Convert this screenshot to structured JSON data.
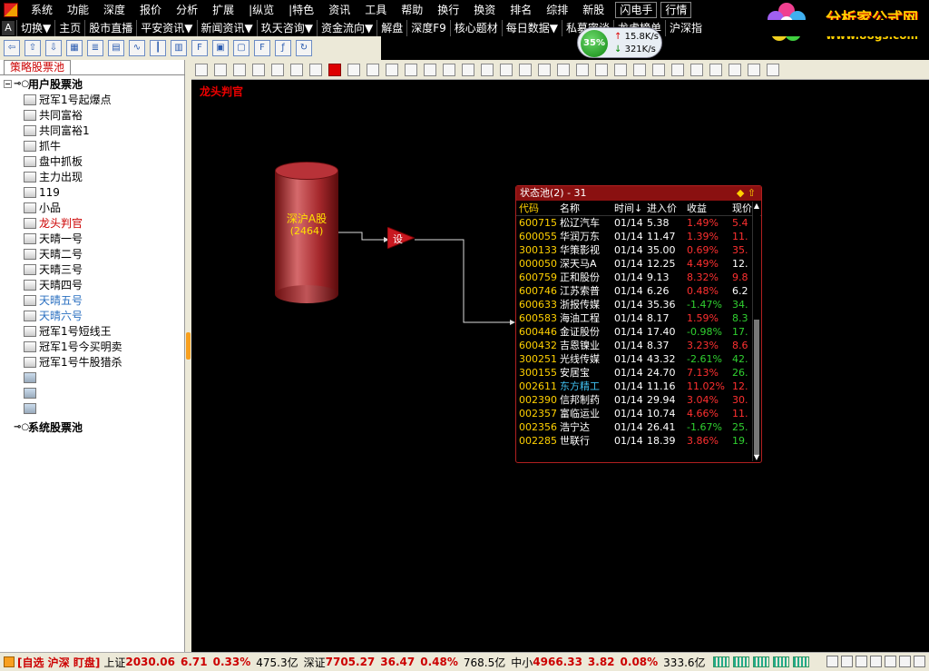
{
  "menu": {
    "items": [
      "系统",
      "功能",
      "深度",
      "报价",
      "分析",
      "扩展",
      "|纵览",
      "|特色",
      "资讯",
      "工具",
      "帮助",
      "换行",
      "换资",
      "排名",
      "综排",
      "新股"
    ],
    "right_buttons": [
      "闪电手",
      "行情"
    ]
  },
  "brand": {
    "title": "分析家公式网",
    "url": "www.88gs.com"
  },
  "navbar": {
    "items": [
      "切换▼",
      "主页",
      "股市直播",
      "平安资讯▼",
      "新闻资讯▼",
      "玖天咨询▼",
      "资金流向▼",
      "解盘",
      "深度F9",
      "核心题材",
      "每日数据▼",
      "私募密谈",
      "龙虎榜单",
      "沪深指"
    ]
  },
  "speed": {
    "percent": "35%",
    "up": "15.8K/s",
    "down": "321K/s"
  },
  "left_panel": {
    "tab": "策略股票池",
    "user_root": "用户股票池",
    "system_root": "系统股票池",
    "user_items": [
      {
        "label": "冠军1号起爆点",
        "style": ""
      },
      {
        "label": "共同富裕",
        "style": ""
      },
      {
        "label": "共同富裕1",
        "style": ""
      },
      {
        "label": "抓牛",
        "style": ""
      },
      {
        "label": "盘中抓板",
        "style": ""
      },
      {
        "label": "主力出现",
        "style": ""
      },
      {
        "label": "119",
        "style": ""
      },
      {
        "label": "小品",
        "style": ""
      },
      {
        "label": "龙头判官",
        "style": "red"
      },
      {
        "label": "天晴一号",
        "style": ""
      },
      {
        "label": "天晴二号",
        "style": ""
      },
      {
        "label": "天晴三号",
        "style": ""
      },
      {
        "label": "天晴四号",
        "style": ""
      },
      {
        "label": "天晴五号",
        "style": "blue"
      },
      {
        "label": "天晴六号",
        "style": "blue"
      },
      {
        "label": "冠军1号短线王",
        "style": ""
      },
      {
        "label": "冠军1号今买明卖",
        "style": ""
      },
      {
        "label": "冠军1号牛股猎杀",
        "style": ""
      },
      {
        "label": "",
        "style": "blank"
      },
      {
        "label": "",
        "style": "blank"
      },
      {
        "label": "",
        "style": "blank"
      }
    ]
  },
  "canvas": {
    "title": "龙头判官",
    "source": {
      "label": "深沪A股",
      "count": "(2464)"
    },
    "filter_label": "设"
  },
  "pool": {
    "title": "状态池(2) - 31",
    "columns": [
      "代码",
      "名称",
      "时间↓",
      "进入价",
      "收益",
      "现价"
    ],
    "rows": [
      {
        "code": "600715",
        "name": "松辽汽车",
        "time": "01/14",
        "price": "5.38",
        "gain": "1.49%",
        "cur": "5.4",
        "dir": "up"
      },
      {
        "code": "600055",
        "name": "华润万东",
        "time": "01/14",
        "price": "11.47",
        "gain": "1.39%",
        "cur": "11.",
        "dir": "up"
      },
      {
        "code": "300133",
        "name": "华策影视",
        "time": "01/14",
        "price": "35.00",
        "gain": "0.69%",
        "cur": "35.",
        "dir": "up"
      },
      {
        "code": "000050",
        "name": "深天马A",
        "time": "01/14",
        "price": "12.25",
        "gain": "4.49%",
        "cur": "12.",
        "dir": "flat"
      },
      {
        "code": "600759",
        "name": "正和股份",
        "time": "01/14",
        "price": "9.13",
        "gain": "8.32%",
        "cur": "9.8",
        "dir": "up"
      },
      {
        "code": "600746",
        "name": "江苏索普",
        "time": "01/14",
        "price": "6.26",
        "gain": "0.48%",
        "cur": "6.2",
        "dir": "flat"
      },
      {
        "code": "600633",
        "name": "浙报传媒",
        "time": "01/14",
        "price": "35.36",
        "gain": "-1.47%",
        "cur": "34.",
        "dir": "down"
      },
      {
        "code": "600583",
        "name": "海油工程",
        "time": "01/14",
        "price": "8.17",
        "gain": "1.59%",
        "cur": "8.3",
        "dir": "gdown"
      },
      {
        "code": "600446",
        "name": "金证股份",
        "time": "01/14",
        "price": "17.40",
        "gain": "-0.98%",
        "cur": "17.",
        "dir": "down"
      },
      {
        "code": "600432",
        "name": "吉恩镍业",
        "time": "01/14",
        "price": "8.37",
        "gain": "3.23%",
        "cur": "8.6",
        "dir": "up"
      },
      {
        "code": "300251",
        "name": "光线传媒",
        "time": "01/14",
        "price": "43.32",
        "gain": "-2.61%",
        "cur": "42.",
        "dir": "down"
      },
      {
        "code": "300155",
        "name": "安居宝",
        "time": "01/14",
        "price": "24.70",
        "gain": "7.13%",
        "cur": "26.",
        "dir": "gdown"
      },
      {
        "code": "002611",
        "name": "东方精工",
        "time": "01/14",
        "price": "11.16",
        "gain": "11.02%",
        "cur": "12.",
        "dir": "up",
        "cyan": true
      },
      {
        "code": "002390",
        "name": "信邦制药",
        "time": "01/14",
        "price": "29.94",
        "gain": "3.04%",
        "cur": "30.",
        "dir": "up"
      },
      {
        "code": "002357",
        "name": "富临运业",
        "time": "01/14",
        "price": "10.74",
        "gain": "4.66%",
        "cur": "11.",
        "dir": "up"
      },
      {
        "code": "002356",
        "name": "浩宁达",
        "time": "01/14",
        "price": "26.41",
        "gain": "-1.67%",
        "cur": "25.",
        "dir": "down"
      },
      {
        "code": "002285",
        "name": "世联行",
        "time": "01/14",
        "price": "18.39",
        "gain": "3.86%",
        "cur": "19.",
        "dir": "gdown"
      }
    ]
  },
  "statusbar": {
    "tag": "[自选 沪深 盯盘]",
    "sh_name": "上证",
    "sh_index": "2030.06",
    "sh_change": "6.71",
    "sh_pct": "0.33%",
    "sh_vol": "475.3亿",
    "sz_name": "深证",
    "sz_index": "7705.27",
    "sz_change": "36.47",
    "sz_pct": "0.48%",
    "sz_vol": "768.5亿",
    "zx_name": "中小",
    "zx_index": "4966.33",
    "zx_change": "3.82",
    "zx_pct": "0.08%",
    "zx_vol": "333.6亿"
  }
}
